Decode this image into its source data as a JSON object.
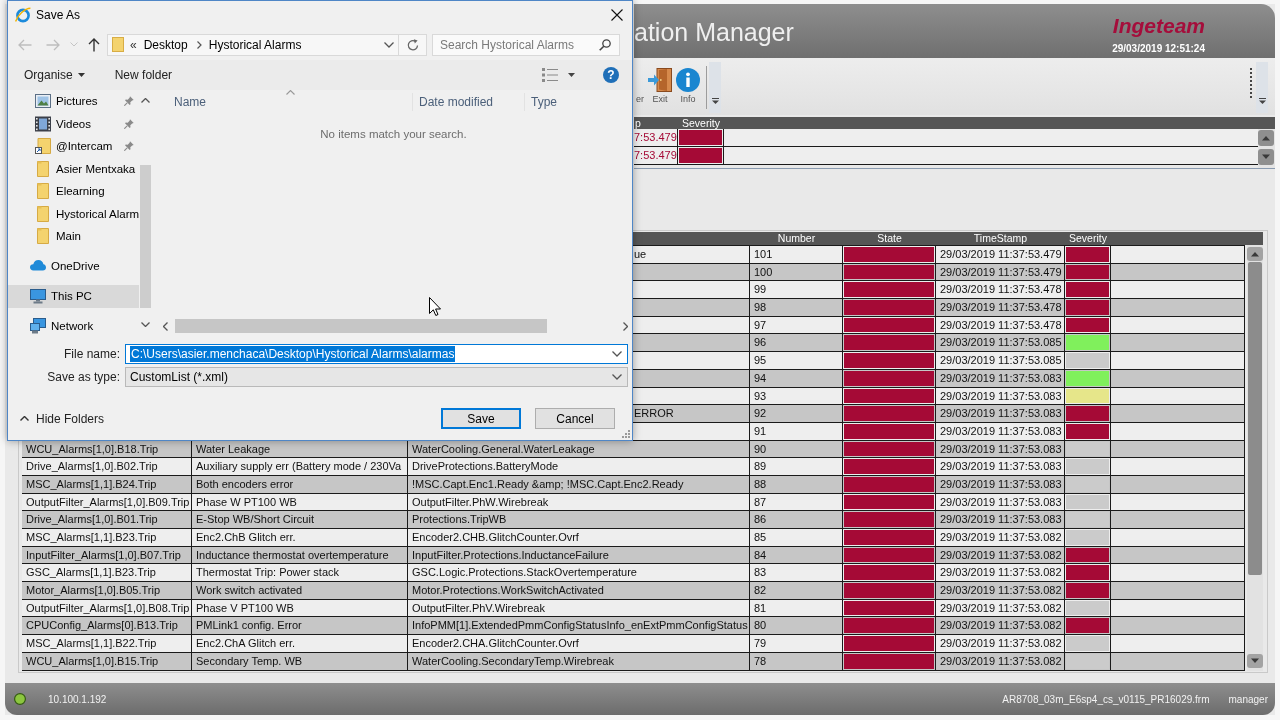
{
  "app": {
    "title": "ation Manager",
    "brand": "Ingeteam",
    "datetime": "29/03/2019 12:51:24",
    "toolbar": [
      {
        "label": "er",
        "kind": "text_only"
      },
      {
        "label": "Exit",
        "kind": "exit"
      },
      {
        "label": "Info",
        "kind": "info"
      }
    ],
    "active_alarms": {
      "columns": [
        "p",
        "Severity"
      ],
      "rows": [
        {
          "timestamp": "7:53.479",
          "severity": {
            "color": "#a50a36"
          }
        },
        {
          "timestamp": "7:53.479",
          "severity": {
            "color": "#a50a36"
          }
        }
      ]
    },
    "alarm_table": {
      "columns": [
        "Number",
        "State",
        "TimeStamp",
        "Severity"
      ],
      "rows": [
        {
          "variable": "ue",
          "number": "101",
          "state": {
            "color": "#a50a36"
          },
          "timestamp": "29/03/2019 11:37:53.479",
          "severity": {
            "color": "#a50a36"
          }
        },
        {
          "number": "100",
          "state": {
            "color": "#a50a36"
          },
          "timestamp": "29/03/2019 11:37:53.479",
          "severity": {
            "color": "#a50a36"
          }
        },
        {
          "number": "99",
          "state": {
            "color": "#a50a36"
          },
          "timestamp": "29/03/2019 11:37:53.478",
          "severity": {
            "color": "#a50a36"
          }
        },
        {
          "number": "98",
          "state": {
            "color": "#a50a36"
          },
          "timestamp": "29/03/2019 11:37:53.478",
          "severity": {
            "color": "#a50a36"
          }
        },
        {
          "number": "97",
          "state": {
            "color": "#a50a36"
          },
          "timestamp": "29/03/2019 11:37:53.478",
          "severity": {
            "color": "#a50a36"
          }
        },
        {
          "number": "96",
          "state": {
            "color": "#a50a36"
          },
          "timestamp": "29/03/2019 11:37:53.085",
          "severity": {
            "color": "#80f05c"
          }
        },
        {
          "number": "95",
          "state": {
            "color": "#a50a36"
          },
          "timestamp": "29/03/2019 11:37:53.085",
          "severity": {
            "color": "#cbcbcb"
          }
        },
        {
          "number": "94",
          "state": {
            "color": "#a50a36"
          },
          "timestamp": "29/03/2019 11:37:53.083",
          "severity": {
            "color": "#80f05c"
          }
        },
        {
          "number": "93",
          "state": {
            "color": "#a50a36"
          },
          "timestamp": "29/03/2019 11:37:53.083",
          "severity": {
            "color": "#e6e68a"
          }
        },
        {
          "variable": "ERROR",
          "number": "92",
          "state": {
            "color": "#a50a36"
          },
          "timestamp": "29/03/2019 11:37:53.083",
          "severity": {
            "color": "#a50a36"
          }
        },
        {
          "number": "91",
          "state": {
            "color": "#a50a36"
          },
          "timestamp": "29/03/2019 11:37:53.083",
          "severity": {
            "color": "#a50a36"
          }
        },
        {
          "tag": "WCU_Alarms[1,0].B18.Trip",
          "description": "Water Leakage",
          "variable": "WaterCooling.General.WaterLeakage",
          "number": "90",
          "state": {
            "color": "#a50a36"
          },
          "timestamp": "29/03/2019 11:37:53.083",
          "severity": {
            "color": "#cbcbcb"
          }
        },
        {
          "tag": "Drive_Alarms[1,0].B02.Trip",
          "description": "Auxiliary supply err (Battery mode / 230Va",
          "variable": "DriveProtections.BatteryMode",
          "number": "89",
          "state": {
            "color": "#a50a36"
          },
          "timestamp": "29/03/2019 11:37:53.083",
          "severity": {
            "color": "#cbcbcb"
          }
        },
        {
          "tag": "MSC_Alarms[1,1].B24.Trip",
          "description": "Both encoders error",
          "variable": "!MSC.Capt.Enc1.Ready &amp; !MSC.Capt.Enc2.Ready",
          "number": "88",
          "state": {
            "color": "#a50a36"
          },
          "timestamp": "29/03/2019 11:37:53.083",
          "severity": {
            "color": "#cbcbcb"
          }
        },
        {
          "tag": "OutputFilter_Alarms[1,0].B09.Trip",
          "description": "Phase W PT100 WB",
          "variable": "OutputFilter.PhW.Wirebreak",
          "number": "87",
          "state": {
            "color": "#a50a36"
          },
          "timestamp": "29/03/2019 11:37:53.083",
          "severity": {
            "color": "#cbcbcb"
          }
        },
        {
          "tag": "Drive_Alarms[1,0].B01.Trip",
          "description": "E-Stop WB/Short Circuit",
          "variable": "Protections.TripWB",
          "number": "86",
          "state": {
            "color": "#a50a36"
          },
          "timestamp": "29/03/2019 11:37:53.083",
          "severity": {
            "color": "#cbcbcb"
          }
        },
        {
          "tag": "MSC_Alarms[1,1].B23.Trip",
          "description": "Enc2.ChB Glitch err.",
          "variable": "Encoder2.CHB.GlitchCounter.Ovrf",
          "number": "85",
          "state": {
            "color": "#a50a36"
          },
          "timestamp": "29/03/2019 11:37:53.082",
          "severity": {
            "color": "#cbcbcb"
          }
        },
        {
          "tag": "InputFilter_Alarms[1,0].B07.Trip",
          "description": "Inductance thermostat overtemperature",
          "variable": "InputFilter.Protections.InductanceFailure",
          "number": "84",
          "state": {
            "color": "#a50a36"
          },
          "timestamp": "29/03/2019 11:37:53.082",
          "severity": {
            "color": "#a50a36"
          }
        },
        {
          "tag": "GSC_Alarms[1,1].B23.Trip",
          "description": "Thermostat Trip: Power stack",
          "variable": "GSC.Logic.Protections.StackOvertemperature",
          "number": "83",
          "state": {
            "color": "#a50a36"
          },
          "timestamp": "29/03/2019 11:37:53.082",
          "severity": {
            "color": "#a50a36"
          }
        },
        {
          "tag": "Motor_Alarms[1,0].B05.Trip",
          "description": "Work switch activated",
          "variable": "Motor.Protections.WorkSwitchActivated",
          "number": "82",
          "state": {
            "color": "#a50a36"
          },
          "timestamp": "29/03/2019 11:37:53.082",
          "severity": {
            "color": "#a50a36"
          }
        },
        {
          "tag": "OutputFilter_Alarms[1,0].B08.Trip",
          "description": "Phase V PT100 WB",
          "variable": "OutputFilter.PhV.Wirebreak",
          "number": "81",
          "state": {
            "color": "#a50a36"
          },
          "timestamp": "29/03/2019 11:37:53.082",
          "severity": {
            "color": "#cbcbcb"
          }
        },
        {
          "tag": "CPUConfig_Alarms[0].B13.Trip",
          "description": "PMLink1 config. Error",
          "variable": "InfoPMM[1].ExtendedPmmConfigStatusInfo_enExtPmmConfigStatus",
          "number": "80",
          "state": {
            "color": "#a50a36"
          },
          "timestamp": "29/03/2019 11:37:53.082",
          "severity": {
            "color": "#a50a36"
          }
        },
        {
          "tag": "MSC_Alarms[1,1].B22.Trip",
          "description": "Enc2.ChA Glitch err.",
          "variable": "Encoder2.CHA.GlitchCounter.Ovrf",
          "number": "79",
          "state": {
            "color": "#a50a36"
          },
          "timestamp": "29/03/2019 11:37:53.082",
          "severity": {
            "color": "#cbcbcb"
          }
        },
        {
          "tag": "WCU_Alarms[1,0].B15.Trip",
          "description": "Secondary Temp. WB",
          "variable": "WaterCooling.SecondaryTemp.Wirebreak",
          "number": "78",
          "state": {
            "color": "#a50a36"
          },
          "timestamp": "29/03/2019 11:37:53.082",
          "severity": {
            "color": "#cbcbcb"
          }
        }
      ]
    }
  },
  "save_dialog": {
    "title": "Save As",
    "path_overflow": "«",
    "breadcrumb": [
      "Desktop",
      "Hystorical Alarms"
    ],
    "search": {
      "placeholder": "Search Hystorical Alarms"
    },
    "commands": [
      {
        "label": "Organise",
        "menu": true
      },
      {
        "label": "New folder",
        "menu": false
      }
    ],
    "help": "?",
    "nav_tree": [
      {
        "children": [
          {
            "label": "Pictures",
            "kind": "pictures",
            "pinned": true,
            "selected": false
          },
          {
            "label": "Videos",
            "kind": "videos",
            "pinned": true,
            "selected": false
          },
          {
            "label": "@Intercam",
            "kind": "shortcut",
            "pinned": true,
            "selected": false
          },
          {
            "label": "Asier Mentxaka",
            "kind": "folder",
            "pinned": false,
            "selected": false
          },
          {
            "label": "Elearning",
            "kind": "folder",
            "pinned": false,
            "selected": false
          },
          {
            "label": "Hystorical Alarm",
            "kind": "folder",
            "pinned": false,
            "selected": false
          },
          {
            "label": "Main",
            "kind": "folder",
            "pinned": false,
            "selected": false
          }
        ]
      },
      {
        "label": "OneDrive",
        "kind": "cloud",
        "pinned": false,
        "selected": false
      },
      {
        "label": "This PC",
        "kind": "computer",
        "pinned": false,
        "selected": true
      },
      {
        "label": "Network",
        "kind": "network",
        "pinned": false,
        "selected": false
      }
    ],
    "columns": [
      {
        "label": "Name",
        "sorted": true
      },
      {
        "label": "Date modified",
        "sorted": false
      },
      {
        "label": "Type",
        "sorted": false
      }
    ],
    "empty_message": "No items match your search.",
    "file_name": {
      "label": "File name:",
      "value": "C:\\Users\\asier.menchaca\\Desktop\\Hystorical Alarms\\alarmas",
      "selected": true
    },
    "save_as_type": {
      "label": "Save as type:",
      "value": "CustomList (*.xml)"
    },
    "hide_folders": "Hide Folders",
    "buttons": [
      {
        "label": "Save",
        "default": true
      },
      {
        "label": "Cancel",
        "default": false
      }
    ]
  },
  "status_bar": {
    "online": true,
    "address": "10.100.1.192",
    "project": "AR8708_03m_E6sp4_cs_v0115_PR16029.frm",
    "user": "manager"
  }
}
